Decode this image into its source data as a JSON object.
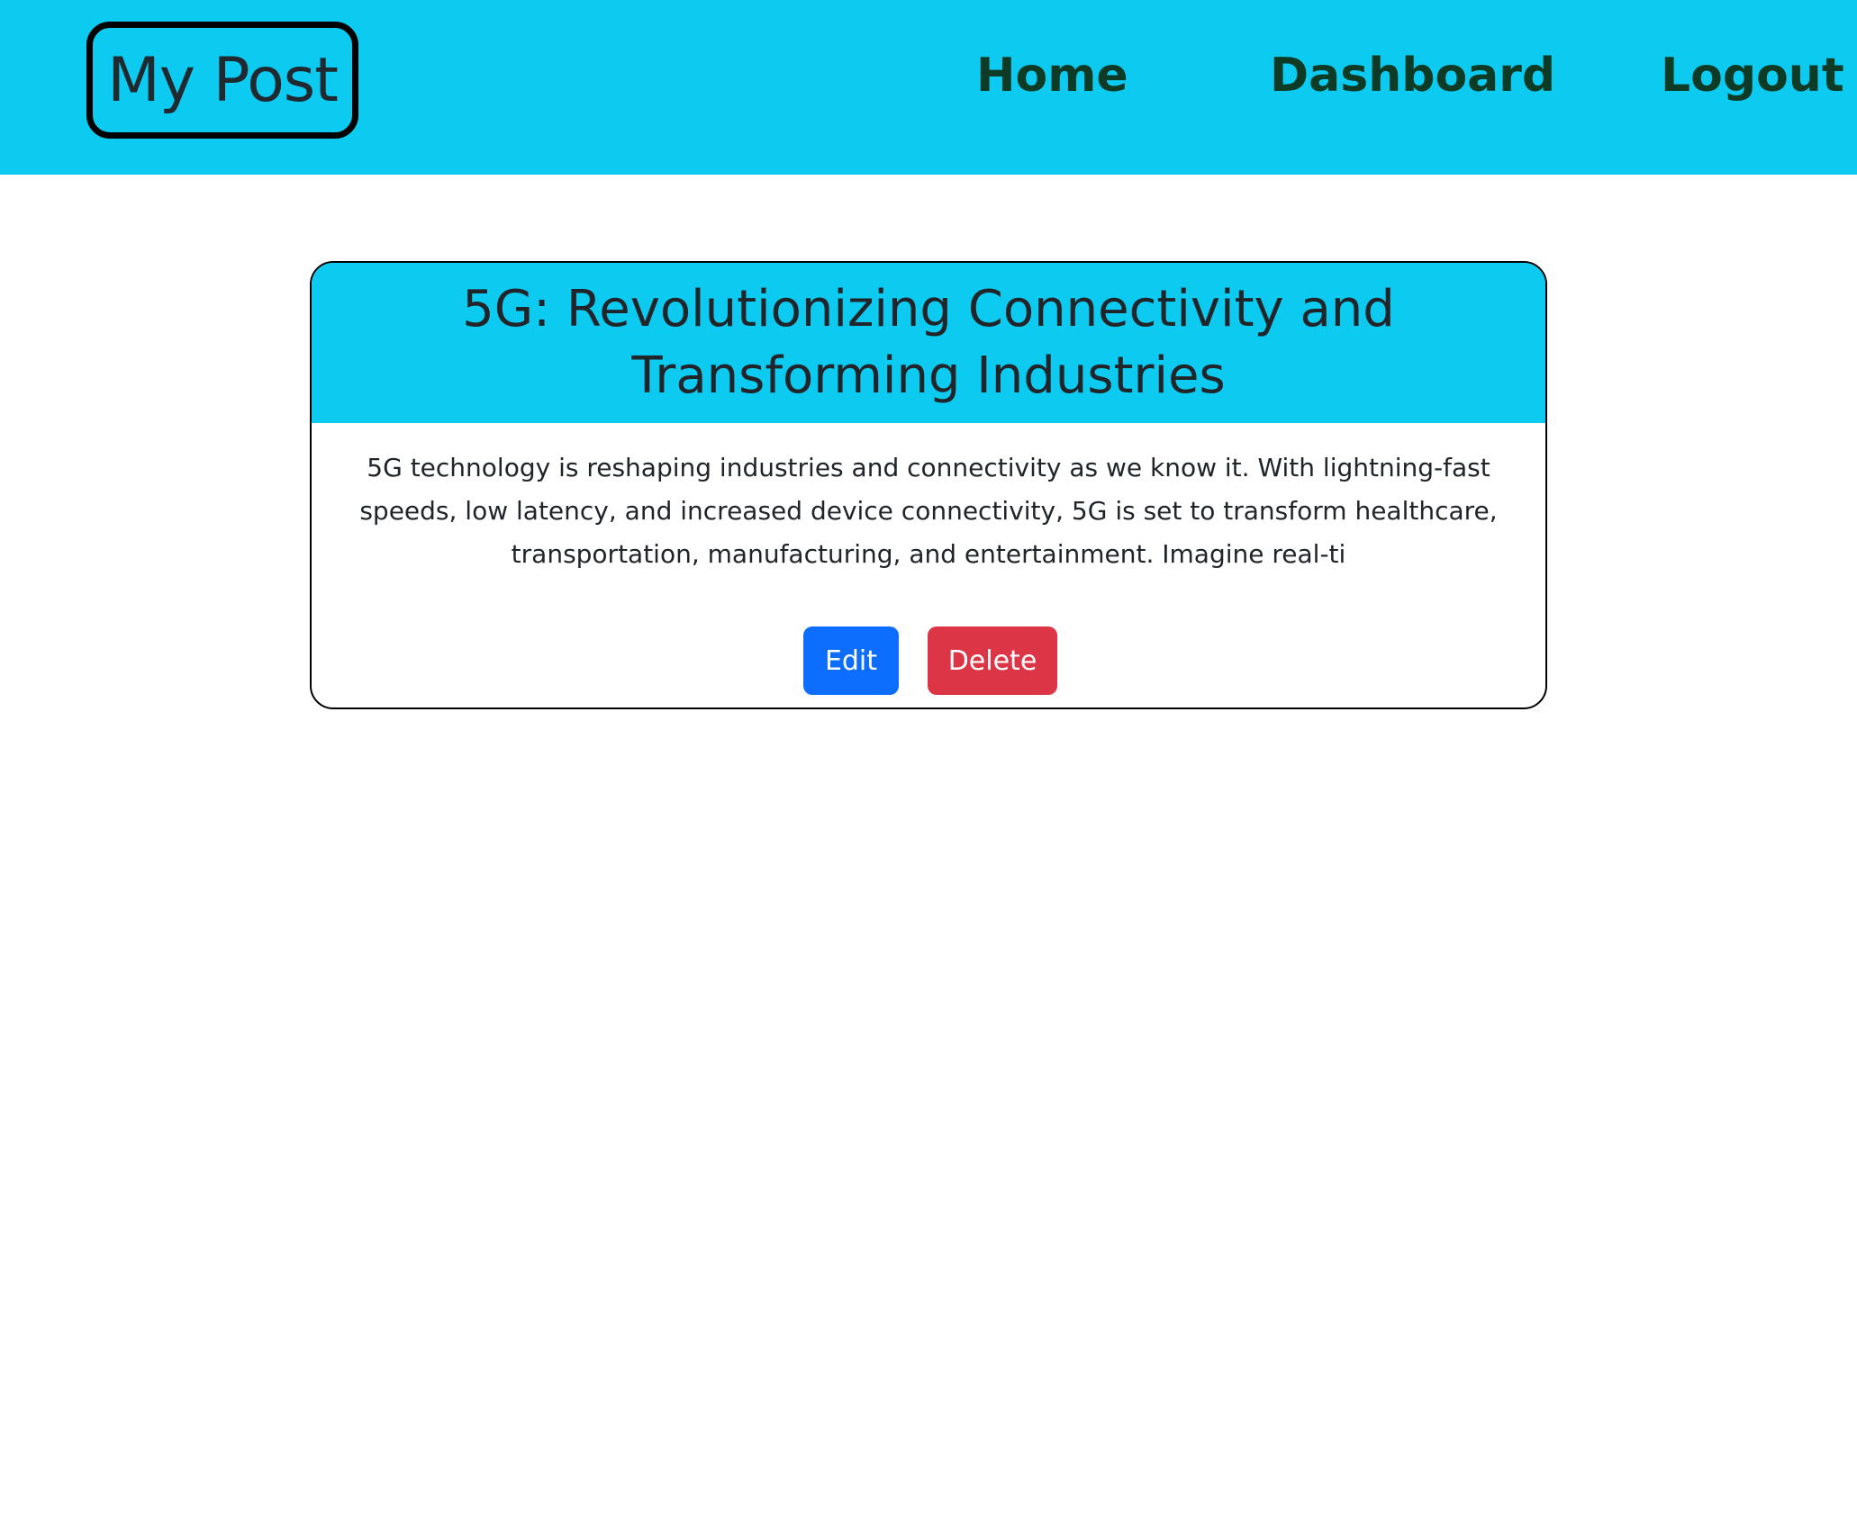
{
  "navbar": {
    "brand": "My Post",
    "links": [
      "Home",
      "Dashboard",
      "Logout"
    ]
  },
  "post": {
    "title": "5G: Revolutionizing Connectivity and Transforming Industries",
    "excerpt": "5G technology is reshaping industries and connectivity as we know it. With lightning-fast speeds, low latency, and increased device connectivity, 5G is set to transform healthcare, transportation, manufacturing, and entertainment. Imagine real-ti",
    "edit_label": "Edit",
    "delete_label": "Delete"
  },
  "colors": {
    "navbar_bg": "#0dcaf0",
    "card_header_bg": "#0dcaf0",
    "nav_link": "#0e3b26",
    "edit_button": "#0d6efd",
    "delete_button": "#dc3545"
  }
}
